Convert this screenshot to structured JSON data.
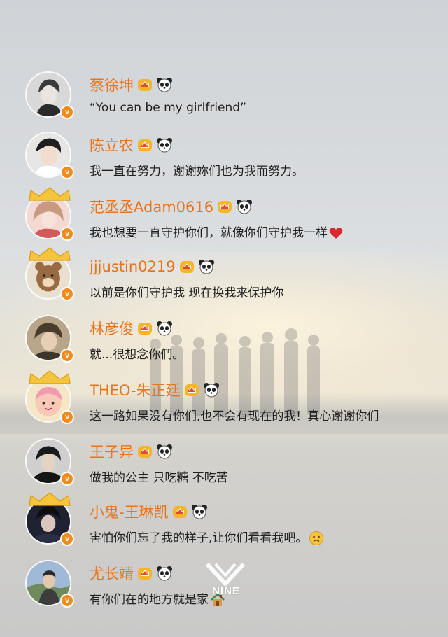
{
  "colors": {
    "name": "#e8741d",
    "text": "#202020",
    "badge": "#f28a1c",
    "heart": "#d9272e"
  },
  "icons": {
    "verified": "verified-v-badge-icon",
    "crown": "crown-icon",
    "panda": "panda-icon"
  },
  "badge_letter": "v",
  "comments": [
    {
      "name": "蔡徐坤",
      "text": "“You can be my girlfriend”",
      "emoji": ""
    },
    {
      "name": "陈立农",
      "text": "我一直在努力，谢谢妳们也为我而努力。",
      "emoji": ""
    },
    {
      "name": "范丞丞Adam0616",
      "text": "我也想要一直守护你们，就像你们守护我一样",
      "emoji": "heart"
    },
    {
      "name": "jjjustin0219",
      "text": "以前是你们守护我  现在换我来保护你",
      "emoji": ""
    },
    {
      "name": "林彦俊",
      "text": "就...很想念你們。",
      "emoji": ""
    },
    {
      "name": "THEO-朱正廷",
      "text": "这一路如果没有你们,也不会有现在的我！真心谢谢你们",
      "emoji": ""
    },
    {
      "name": "王子异",
      "text": "做我的公主 只吃糖 不吃苦",
      "emoji": ""
    },
    {
      "name": "小鬼-王琳凯",
      "text": "害怕你们忘了我的样子,让你们看看我吧。",
      "emoji": "sad-face"
    },
    {
      "name": "尤长靖",
      "text": "有你们在的地方就是家",
      "emoji": "house"
    }
  ],
  "watermark": {
    "text": "NINE"
  }
}
